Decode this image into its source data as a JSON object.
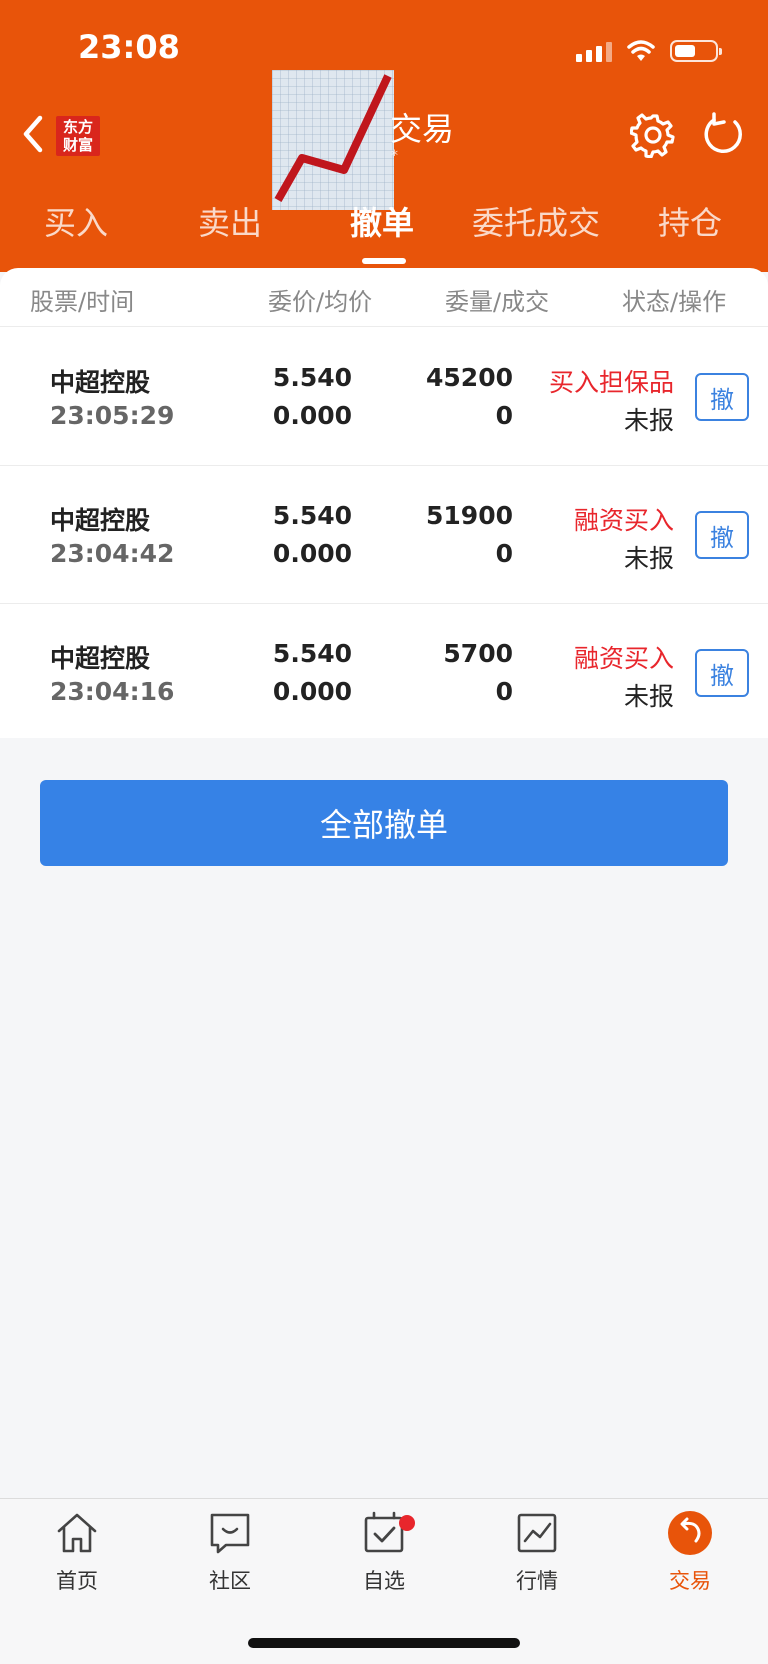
{
  "status_bar": {
    "time": "23:08"
  },
  "header": {
    "logo_line1": "东方",
    "logo_line2": "财富",
    "title": "交易",
    "subtitle": "*"
  },
  "tabs": [
    {
      "label": "买入"
    },
    {
      "label": "卖出"
    },
    {
      "label": "撤单",
      "active": true
    },
    {
      "label": "委托成交"
    },
    {
      "label": "持仓"
    }
  ],
  "columns": [
    "股票/时间",
    "委价/均价",
    "委量/成交",
    "状态/操作"
  ],
  "orders": [
    {
      "name": "中超控股",
      "time": "23:05:29",
      "price": "5.540",
      "avg_price": "0.000",
      "quantity": "45200",
      "filled": "0",
      "type": "买入担保品",
      "status": "未报",
      "action": "撤"
    },
    {
      "name": "中超控股",
      "time": "23:04:42",
      "price": "5.540",
      "avg_price": "0.000",
      "quantity": "51900",
      "filled": "0",
      "type": "融资买入",
      "status": "未报",
      "action": "撤"
    },
    {
      "name": "中超控股",
      "time": "23:04:16",
      "price": "5.540",
      "avg_price": "0.000",
      "quantity": "5700",
      "filled": "0",
      "type": "融资买入",
      "status": "未报",
      "action": "撤"
    }
  ],
  "cancel_all_label": "全部撤单",
  "bottom_nav": [
    {
      "label": "首页",
      "icon": "home-icon"
    },
    {
      "label": "社区",
      "icon": "community-icon"
    },
    {
      "label": "自选",
      "icon": "watchlist-icon",
      "badge": true
    },
    {
      "label": "行情",
      "icon": "market-icon"
    },
    {
      "label": "交易",
      "icon": "trade-icon",
      "active": true
    }
  ],
  "colors": {
    "brand": "#e8540a",
    "primary_button": "#3682e6",
    "alert_red": "#e8262c"
  }
}
